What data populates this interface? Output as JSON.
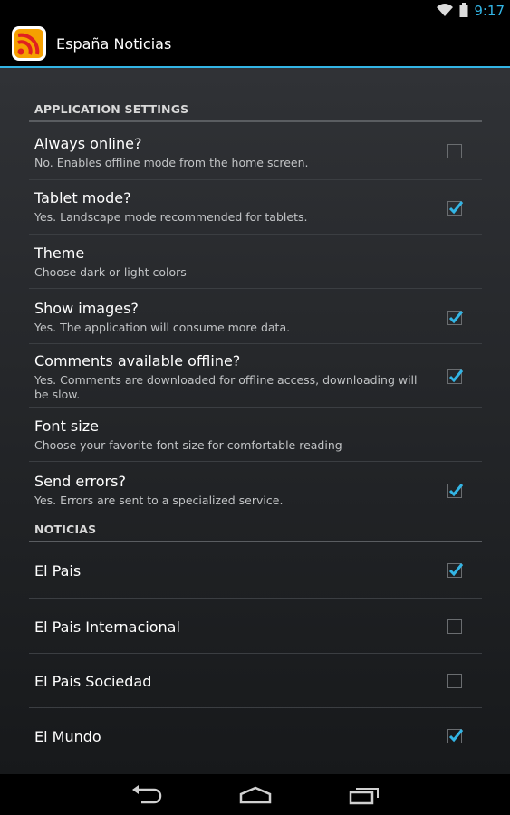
{
  "status_bar": {
    "time": "9:17",
    "icons": [
      "wifi-icon",
      "battery-icon"
    ]
  },
  "action_bar": {
    "title": "España Noticias",
    "icon": "rss-icon"
  },
  "sections": [
    {
      "header": "APPLICATION SETTINGS"
    },
    {
      "header": "NOTICIAS"
    }
  ],
  "settings": [
    {
      "title": "Always online?",
      "summary": "No. Enables offline mode from the home screen.",
      "checked": false
    },
    {
      "title": "Tablet mode?",
      "summary": "Yes. Landscape mode recommended for tablets.",
      "checked": true
    },
    {
      "title": "Theme",
      "summary": "Choose dark or light colors"
    },
    {
      "title": "Show images?",
      "summary": "Yes. The application will consume more data.",
      "checked": true
    },
    {
      "title": "Comments available offline?",
      "summary": "Yes. Comments are downloaded for offline access, downloading will be slow.",
      "checked": true
    },
    {
      "title": "Font size",
      "summary": "Choose your favorite font size for comfortable reading"
    },
    {
      "title": "Send errors?",
      "summary": "Yes. Errors are sent to a specialized service.",
      "checked": true
    }
  ],
  "noticias": [
    {
      "title": "El Pais",
      "checked": true
    },
    {
      "title": "El Pais Internacional",
      "checked": false
    },
    {
      "title": "El Pais Sociedad",
      "checked": false
    },
    {
      "title": "El Mundo",
      "checked": true
    }
  ],
  "nav_bar": {
    "icons": [
      "back-icon",
      "home-icon",
      "recent-apps-icon"
    ]
  },
  "colors": {
    "accent": "#33b5e5",
    "checkbox_border": "#6a6d70"
  }
}
